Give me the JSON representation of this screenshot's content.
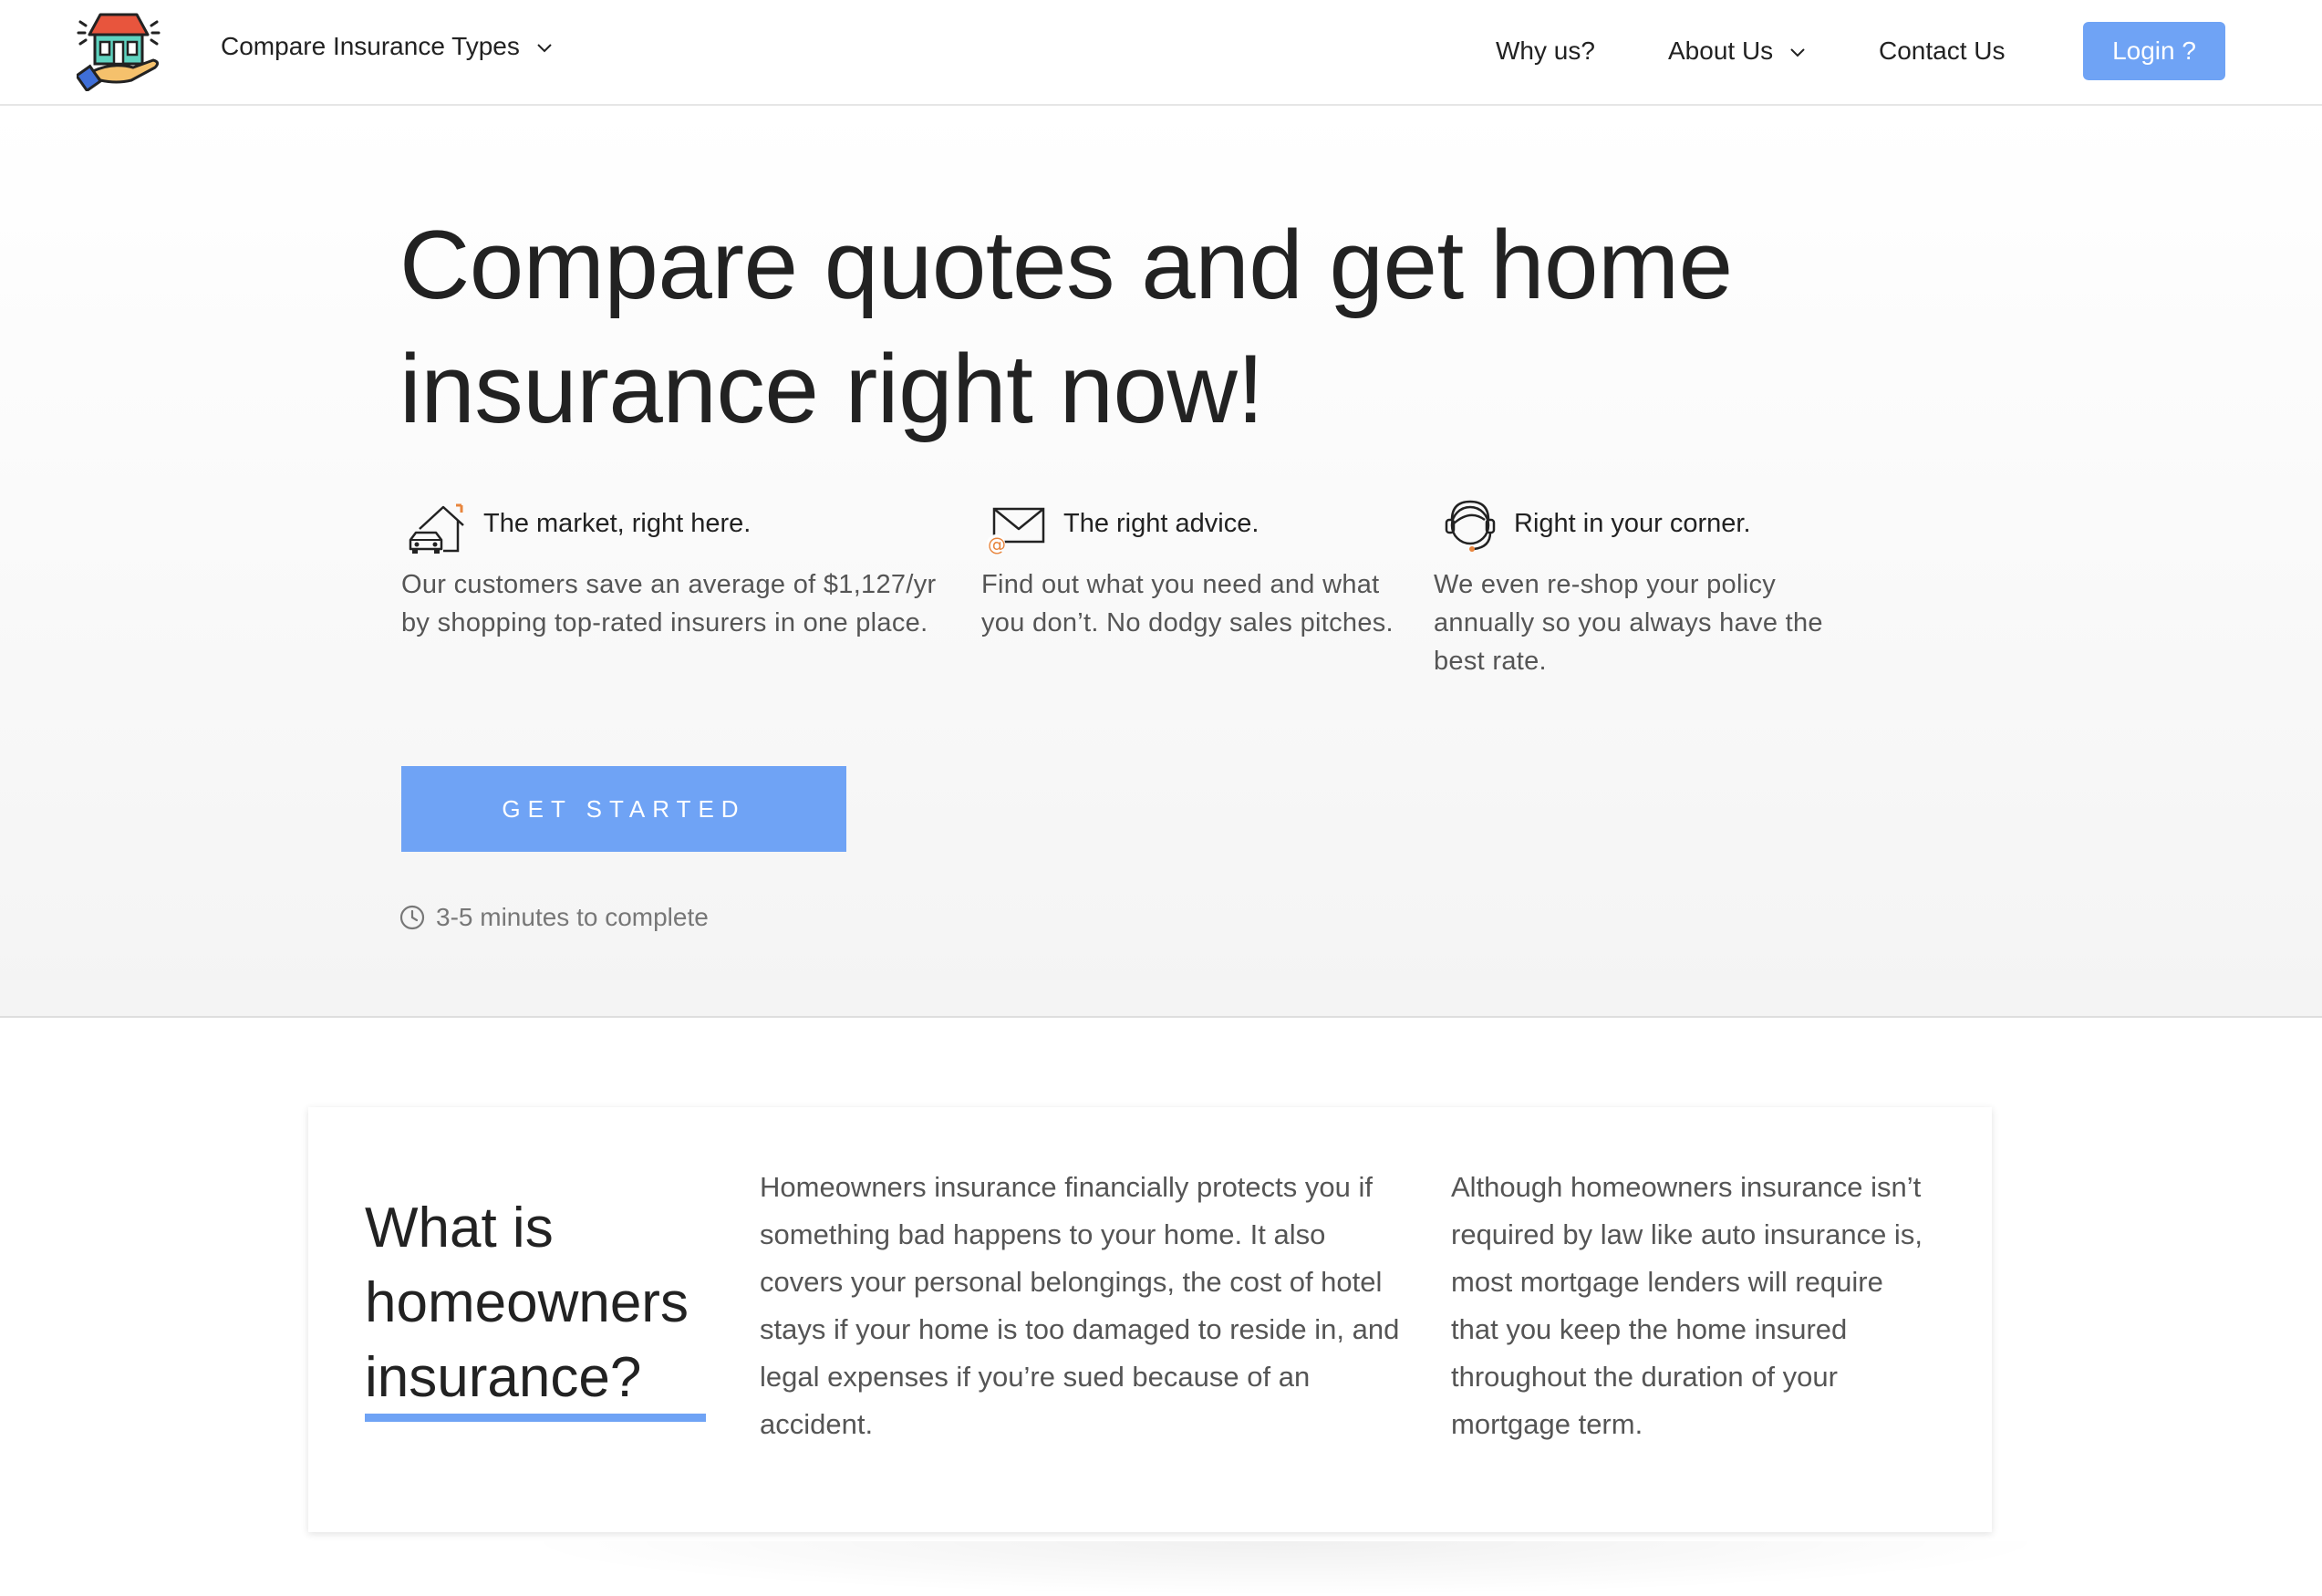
{
  "nav": {
    "compare_label": "Compare Insurance Types",
    "why_label": "Why us?",
    "about_label": "About Us",
    "contact_label": "Contact Us",
    "login_label": "Login ?"
  },
  "hero": {
    "title": "Compare quotes and get home insurance right now!",
    "features": [
      {
        "icon": "house-car-icon",
        "title": "The market, right here.",
        "body": "Our customers save an average of $1,127/yr by shopping top-rated insurers in one place."
      },
      {
        "icon": "envelope-at-icon",
        "title": "The right advice.",
        "body": "Find out what you need and what you don’t. No dodgy sales pitches."
      },
      {
        "icon": "headset-agent-icon",
        "title": "Right in your corner.",
        "body": "We even re-shop your policy annually so you always have the best rate."
      }
    ],
    "cta_label": "GET STARTED",
    "time_note": "3-5 minutes to complete"
  },
  "info": {
    "title": "What is homeowners insurance?",
    "para1": "Homeowners insurance financially protects you if something bad happens to your home. It also covers your personal belongings, the cost of hotel stays if your home is too damaged to reside in, and legal expenses if you’re sued because of an accident.",
    "para2": "Although homeowners insurance isn’t required by law like auto insurance is, most mortgage lenders will require that you keep the home insured throughout the duration of your mortgage term."
  },
  "colors": {
    "accent": "#6fa3f5",
    "roof": "#e8553d",
    "house": "#5fd3c0",
    "hand": "#f5c16c",
    "sleeve": "#3f6fd8"
  }
}
